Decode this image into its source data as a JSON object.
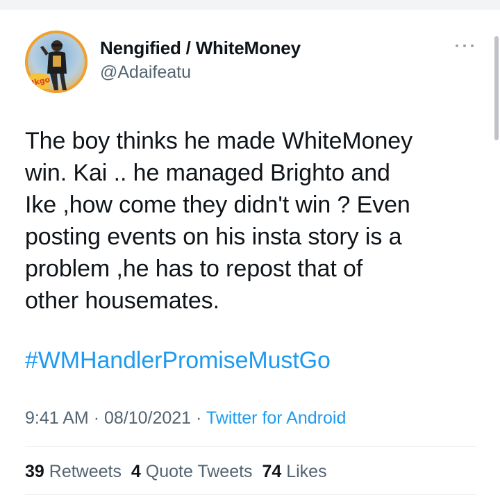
{
  "tweet": {
    "author": {
      "display_name": "Nengified / WhiteMoney",
      "handle": "@Adaifeatu",
      "avatar_badge_text": "Nkgo"
    },
    "text": "The boy thinks he made WhiteMoney\nwin. Kai .. he managed Brighto and\nIke ,how come they didn't win ? Even\nposting events  on his insta story is a\nproblem ,he has to repost that of\nother housemates.",
    "hashtag": "#WMHandlerPromiseMustGo",
    "time": "9:41 AM",
    "date": "08/10/2021",
    "separator": "·",
    "source": "Twitter for Android",
    "stats": {
      "retweets_count": "39",
      "retweets_label": "Retweets",
      "quotes_count": "4",
      "quotes_label": "Quote Tweets",
      "likes_count": "74",
      "likes_label": "Likes"
    }
  },
  "colors": {
    "link": "#1d9bf0",
    "secondary_text": "#536471",
    "primary_text": "#0f1419"
  },
  "icons": {
    "more": "more-horizontal-icon"
  }
}
